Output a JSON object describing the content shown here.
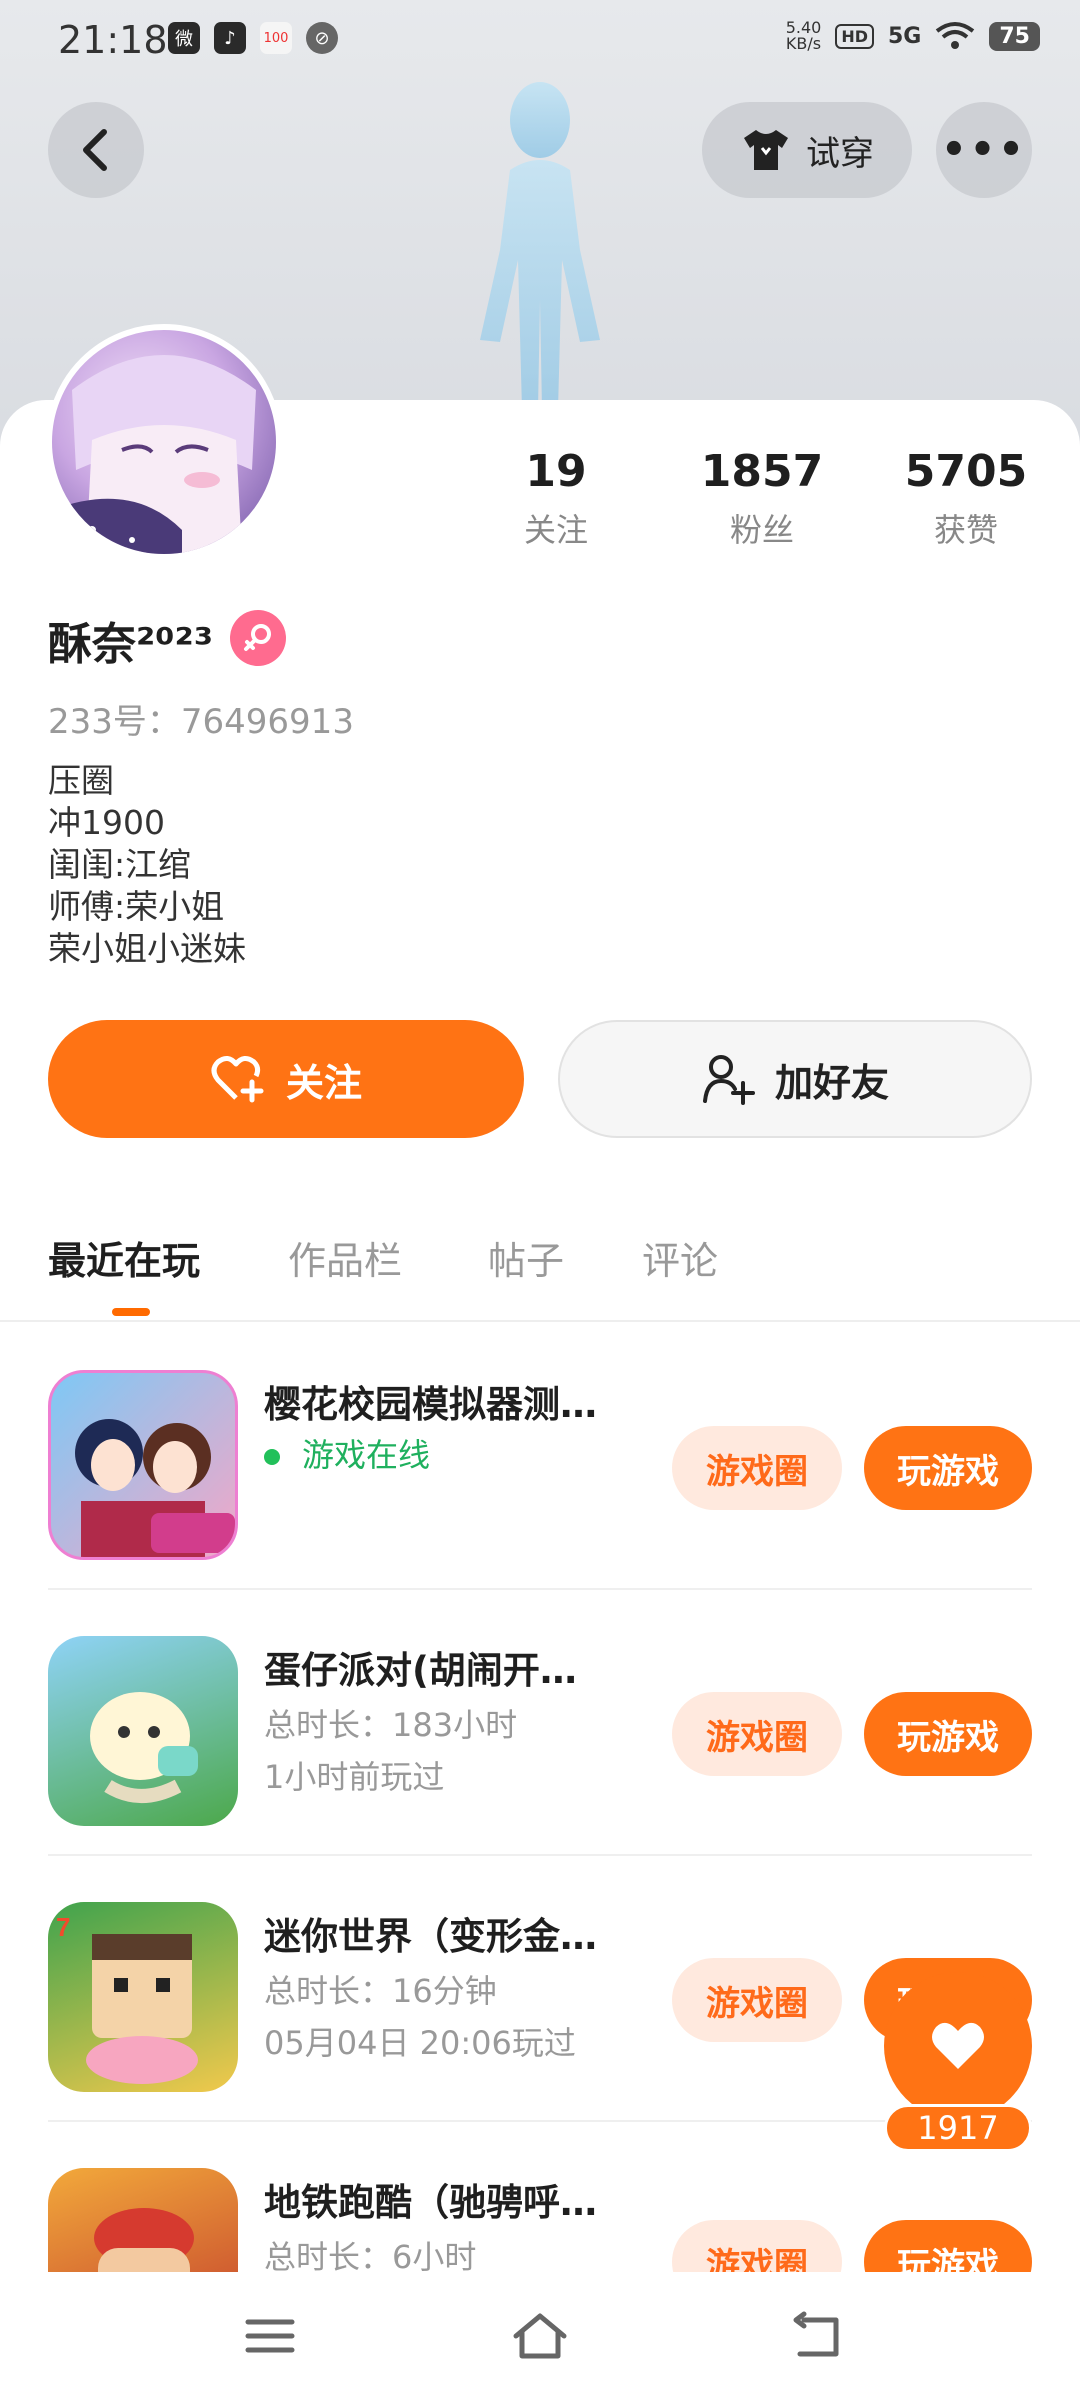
{
  "status_bar": {
    "time": "21:18",
    "apps": [
      "微",
      "♪",
      "100",
      "⊘"
    ],
    "net_speed": "5.40",
    "net_unit": "KB/s",
    "hd": "HD",
    "signal": "5G",
    "battery": "75"
  },
  "header": {
    "tryon_label": "试穿",
    "more_label": "•••"
  },
  "profile": {
    "nickname": "酥奈²⁰²³",
    "id_text": "233号：76496913",
    "bio": [
      "压圈",
      "冲1900",
      "闺闺:江绾",
      "师傅:荣小姐",
      "荣小姐小迷妹"
    ],
    "stats": [
      {
        "value": "19",
        "label": "关注"
      },
      {
        "value": "1857",
        "label": "粉丝"
      },
      {
        "value": "5705",
        "label": "获赞"
      }
    ],
    "follow_label": "关注",
    "add_friend_label": "加好友"
  },
  "tabs": [
    "最近在玩",
    "作品栏",
    "帖子",
    "评论"
  ],
  "games": [
    {
      "title": "樱花校园模拟器测…",
      "line1": "游戏在线",
      "line2": "",
      "circle": "游戏圈",
      "play": "玩游戏"
    },
    {
      "title": "蛋仔派对(胡闹开…",
      "line1": "总时长：183小时",
      "line2": "1小时前玩过",
      "circle": "游戏圈",
      "play": "玩游戏"
    },
    {
      "title": "迷你世界（变形金…",
      "line1": "总时长：16分钟",
      "line2": "05月04日 20:06玩过",
      "circle": "游戏圈",
      "play": "玩游戏"
    },
    {
      "title": "地铁跑酷（驰骋呼…",
      "line1": "总时长：6小时",
      "line2": "",
      "circle": "游戏圈",
      "play": "玩游戏"
    }
  ],
  "like_float": {
    "count": "1917"
  },
  "colors": {
    "accent": "#ff7314",
    "online": "#1fb05e",
    "gender": "#ff6b8f"
  }
}
